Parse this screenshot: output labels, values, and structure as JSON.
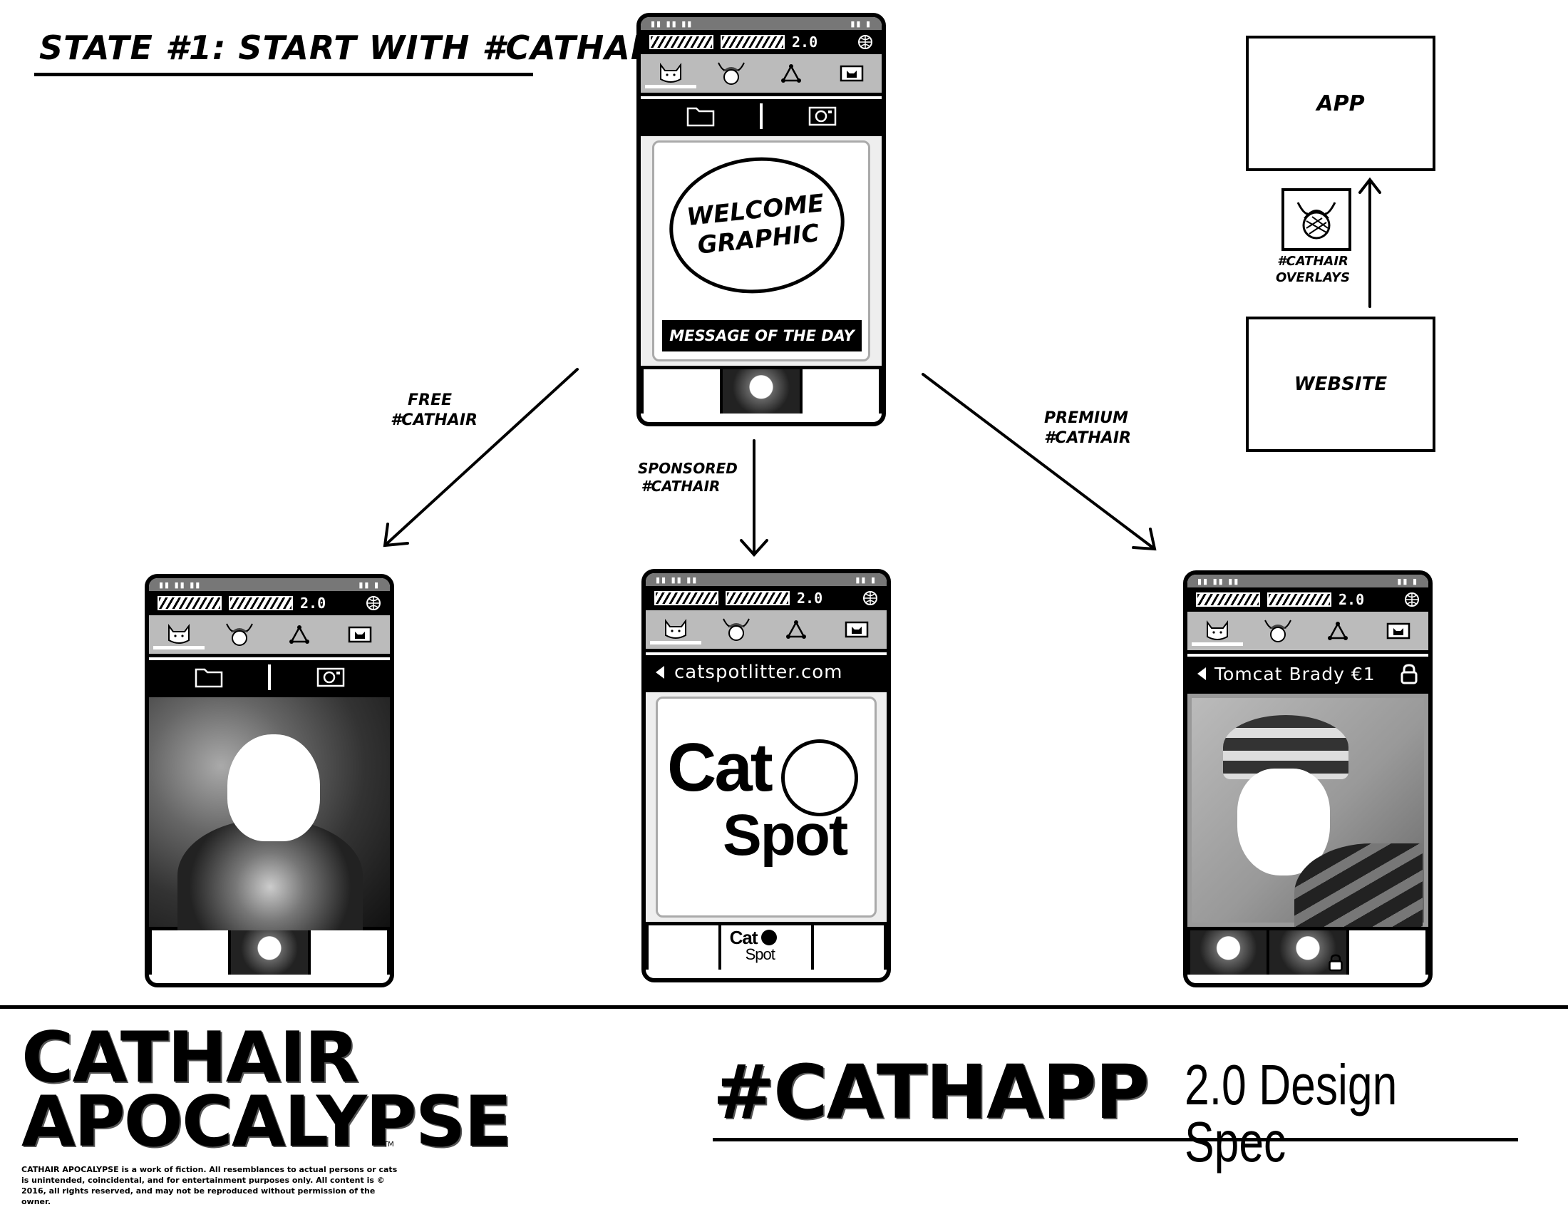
{
  "page_title": "State #1: Start with #Cathair",
  "phones": {
    "top": {
      "version": "2.0",
      "welcome": "Welcome Graphic",
      "message_bar": "Message of the Day"
    },
    "free": {
      "version": "2.0"
    },
    "sponsored": {
      "version": "2.0",
      "url": "catspotlitter.com",
      "logo_word1": "Cat",
      "logo_word2": "Spot",
      "thumb_logo_word1": "Cat",
      "thumb_logo_word2": "Spot"
    },
    "premium": {
      "version": "2.0",
      "title": "Tomcat Brady €1"
    }
  },
  "arrows": {
    "free": "FREE #CATHAIR",
    "sponsored": "SPONSORED #CATHAIR",
    "premium": "PREMIUM #CATHAIR"
  },
  "flow": {
    "app": "APP",
    "website": "WEBSITE",
    "overlay_label": "#CATHAIR OVERLAYS"
  },
  "footer": {
    "brand_line1": "CATHAIR",
    "brand_line2": "APOCALYPSE",
    "tm": "TM",
    "disclaimer": "CATHAIR APOCALYPSE is a work of fiction. All resemblances to actual persons or cats is unintended, coincidental, and for entertainment purposes only. All content is © 2016, all rights reserved, and may not be reproduced without permission of the owner.",
    "spec_hash": "#CATHAPP",
    "spec_rest": "2.0 Design Spec"
  },
  "colors": {
    "ink": "#000000",
    "paper": "#ffffff",
    "tabbar": "#bbbbbb",
    "statusbar": "#777777"
  }
}
